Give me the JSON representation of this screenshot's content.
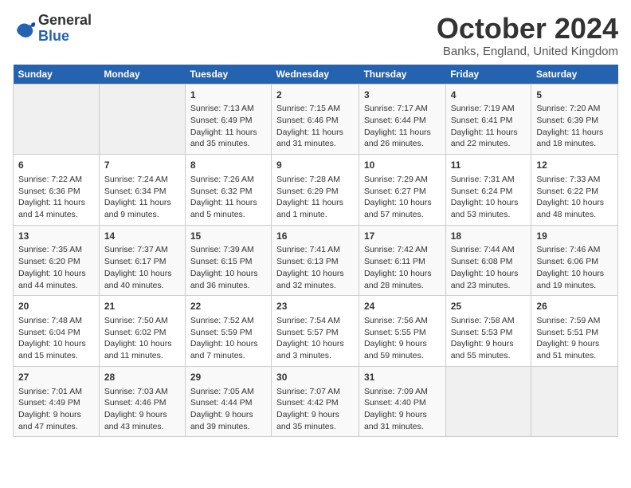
{
  "header": {
    "logo_line1": "General",
    "logo_line2": "Blue",
    "month_title": "October 2024",
    "location": "Banks, England, United Kingdom"
  },
  "days_of_week": [
    "Sunday",
    "Monday",
    "Tuesday",
    "Wednesday",
    "Thursday",
    "Friday",
    "Saturday"
  ],
  "weeks": [
    [
      {
        "day": "",
        "detail": ""
      },
      {
        "day": "",
        "detail": ""
      },
      {
        "day": "1",
        "detail": "Sunrise: 7:13 AM\nSunset: 6:49 PM\nDaylight: 11 hours\nand 35 minutes."
      },
      {
        "day": "2",
        "detail": "Sunrise: 7:15 AM\nSunset: 6:46 PM\nDaylight: 11 hours\nand 31 minutes."
      },
      {
        "day": "3",
        "detail": "Sunrise: 7:17 AM\nSunset: 6:44 PM\nDaylight: 11 hours\nand 26 minutes."
      },
      {
        "day": "4",
        "detail": "Sunrise: 7:19 AM\nSunset: 6:41 PM\nDaylight: 11 hours\nand 22 minutes."
      },
      {
        "day": "5",
        "detail": "Sunrise: 7:20 AM\nSunset: 6:39 PM\nDaylight: 11 hours\nand 18 minutes."
      }
    ],
    [
      {
        "day": "6",
        "detail": "Sunrise: 7:22 AM\nSunset: 6:36 PM\nDaylight: 11 hours\nand 14 minutes."
      },
      {
        "day": "7",
        "detail": "Sunrise: 7:24 AM\nSunset: 6:34 PM\nDaylight: 11 hours\nand 9 minutes."
      },
      {
        "day": "8",
        "detail": "Sunrise: 7:26 AM\nSunset: 6:32 PM\nDaylight: 11 hours\nand 5 minutes."
      },
      {
        "day": "9",
        "detail": "Sunrise: 7:28 AM\nSunset: 6:29 PM\nDaylight: 11 hours\nand 1 minute."
      },
      {
        "day": "10",
        "detail": "Sunrise: 7:29 AM\nSunset: 6:27 PM\nDaylight: 10 hours\nand 57 minutes."
      },
      {
        "day": "11",
        "detail": "Sunrise: 7:31 AM\nSunset: 6:24 PM\nDaylight: 10 hours\nand 53 minutes."
      },
      {
        "day": "12",
        "detail": "Sunrise: 7:33 AM\nSunset: 6:22 PM\nDaylight: 10 hours\nand 48 minutes."
      }
    ],
    [
      {
        "day": "13",
        "detail": "Sunrise: 7:35 AM\nSunset: 6:20 PM\nDaylight: 10 hours\nand 44 minutes."
      },
      {
        "day": "14",
        "detail": "Sunrise: 7:37 AM\nSunset: 6:17 PM\nDaylight: 10 hours\nand 40 minutes."
      },
      {
        "day": "15",
        "detail": "Sunrise: 7:39 AM\nSunset: 6:15 PM\nDaylight: 10 hours\nand 36 minutes."
      },
      {
        "day": "16",
        "detail": "Sunrise: 7:41 AM\nSunset: 6:13 PM\nDaylight: 10 hours\nand 32 minutes."
      },
      {
        "day": "17",
        "detail": "Sunrise: 7:42 AM\nSunset: 6:11 PM\nDaylight: 10 hours\nand 28 minutes."
      },
      {
        "day": "18",
        "detail": "Sunrise: 7:44 AM\nSunset: 6:08 PM\nDaylight: 10 hours\nand 23 minutes."
      },
      {
        "day": "19",
        "detail": "Sunrise: 7:46 AM\nSunset: 6:06 PM\nDaylight: 10 hours\nand 19 minutes."
      }
    ],
    [
      {
        "day": "20",
        "detail": "Sunrise: 7:48 AM\nSunset: 6:04 PM\nDaylight: 10 hours\nand 15 minutes."
      },
      {
        "day": "21",
        "detail": "Sunrise: 7:50 AM\nSunset: 6:02 PM\nDaylight: 10 hours\nand 11 minutes."
      },
      {
        "day": "22",
        "detail": "Sunrise: 7:52 AM\nSunset: 5:59 PM\nDaylight: 10 hours\nand 7 minutes."
      },
      {
        "day": "23",
        "detail": "Sunrise: 7:54 AM\nSunset: 5:57 PM\nDaylight: 10 hours\nand 3 minutes."
      },
      {
        "day": "24",
        "detail": "Sunrise: 7:56 AM\nSunset: 5:55 PM\nDaylight: 9 hours\nand 59 minutes."
      },
      {
        "day": "25",
        "detail": "Sunrise: 7:58 AM\nSunset: 5:53 PM\nDaylight: 9 hours\nand 55 minutes."
      },
      {
        "day": "26",
        "detail": "Sunrise: 7:59 AM\nSunset: 5:51 PM\nDaylight: 9 hours\nand 51 minutes."
      }
    ],
    [
      {
        "day": "27",
        "detail": "Sunrise: 7:01 AM\nSunset: 4:49 PM\nDaylight: 9 hours\nand 47 minutes."
      },
      {
        "day": "28",
        "detail": "Sunrise: 7:03 AM\nSunset: 4:46 PM\nDaylight: 9 hours\nand 43 minutes."
      },
      {
        "day": "29",
        "detail": "Sunrise: 7:05 AM\nSunset: 4:44 PM\nDaylight: 9 hours\nand 39 minutes."
      },
      {
        "day": "30",
        "detail": "Sunrise: 7:07 AM\nSunset: 4:42 PM\nDaylight: 9 hours\nand 35 minutes."
      },
      {
        "day": "31",
        "detail": "Sunrise: 7:09 AM\nSunset: 4:40 PM\nDaylight: 9 hours\nand 31 minutes."
      },
      {
        "day": "",
        "detail": ""
      },
      {
        "day": "",
        "detail": ""
      }
    ]
  ]
}
